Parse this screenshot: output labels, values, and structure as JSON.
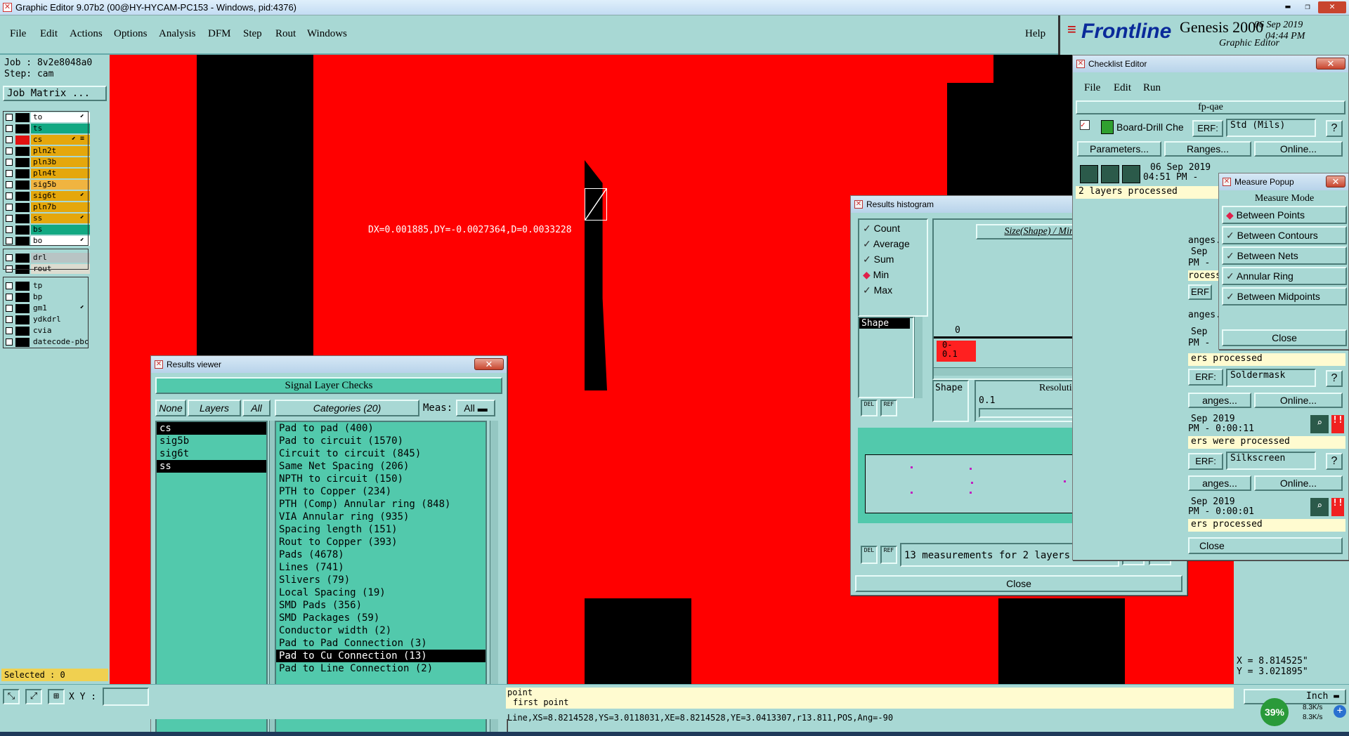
{
  "window": {
    "title": "Graphic Editor 9.07b2 (00@HY-HYCAM-PC153 - Windows, pid:4376)"
  },
  "menu": [
    "File",
    "Edit",
    "Actions",
    "Options",
    "Analysis",
    "DFM",
    "Step",
    "Rout",
    "Windows"
  ],
  "help": "Help",
  "brand": {
    "logo": "Frontline",
    "product": "Genesis 2000",
    "subtitle": "Graphic Editor",
    "date": "06 Sep 2019",
    "time": "04:44 PM"
  },
  "job": {
    "job_label": "Job : 8v2e8048a0",
    "step_label": "Step: cam",
    "job_matrix": "Job Matrix ..."
  },
  "layers": [
    {
      "name": "to",
      "color": "#ffffff",
      "sw": "#000000",
      "icon": "⬋"
    },
    {
      "name": "ts",
      "color": "#12a882",
      "sw": "#000000",
      "icon": ""
    },
    {
      "name": "cs",
      "color": "#e5a70c",
      "sw": "#e11111",
      "icon": "⬋ ≡"
    },
    {
      "name": "pln2t",
      "color": "#e5a70c",
      "sw": "#000000",
      "icon": ""
    },
    {
      "name": "pln3b",
      "color": "#e5a70c",
      "sw": "#000000",
      "icon": ""
    },
    {
      "name": "pln4t",
      "color": "#e5a70c",
      "sw": "#000000",
      "icon": ""
    },
    {
      "name": "sig5b",
      "color": "#f0b440",
      "sw": "#000000",
      "icon": ""
    },
    {
      "name": "sig6t",
      "color": "#e5a70c",
      "sw": "#000000",
      "icon": "⬋"
    },
    {
      "name": "pln7b",
      "color": "#e5a70c",
      "sw": "#000000",
      "icon": ""
    },
    {
      "name": "ss",
      "color": "#e5a70c",
      "sw": "#000000",
      "icon": "⬋"
    },
    {
      "name": "bs",
      "color": "#12a882",
      "sw": "#000000",
      "icon": ""
    },
    {
      "name": "bo",
      "color": "#ffffff",
      "sw": "#000000",
      "icon": "⬋"
    },
    {
      "name": "drl",
      "color": "#b8c4c4",
      "sw": "#000000",
      "icon": ""
    },
    {
      "name": "rout",
      "color": "#dcdcd0",
      "sw": "#000000",
      "icon": ""
    },
    {
      "name": "tp",
      "color": "#a8d8d4",
      "sw": "#000000",
      "icon": ""
    },
    {
      "name": "bp",
      "color": "#a8d8d4",
      "sw": "#000000",
      "icon": ""
    },
    {
      "name": "gm1",
      "color": "#a8d8d4",
      "sw": "#000000",
      "icon": "⬋"
    },
    {
      "name": "ydkdrl",
      "color": "#a8d8d4",
      "sw": "#000000",
      "icon": ""
    },
    {
      "name": "cvia",
      "color": "#a8d8d4",
      "sw": "#000000",
      "icon": ""
    },
    {
      "name": "datecode-pbc",
      "color": "#a8d8d4",
      "sw": "#000000",
      "icon": ""
    }
  ],
  "selected": "Selected : 0",
  "xy_label": "X Y :",
  "canvas": {
    "measure_text": "DX=0.001885,DY=-0.0027364,D=0.0033228"
  },
  "results_viewer": {
    "title": "Results viewer",
    "header": "Signal Layer Checks",
    "none": "None",
    "layers_btn": "Layers",
    "all": "All",
    "categories_btn": "Categories (20)",
    "meas_label": "Meas:",
    "meas_value": "All",
    "layer_list": [
      "cs",
      "sig5b",
      "sig6t",
      "ss"
    ],
    "layer_selected": [
      true,
      false,
      false,
      true
    ],
    "categories": [
      "Pad to pad (400)",
      "Pad to circuit (1570)",
      "Circuit to circuit (845)",
      "Same Net Spacing (206)",
      "NPTH to circuit (150)",
      "PTH to Copper (234)",
      "PTH (Comp) Annular ring (848)",
      "VIA Annular ring (935)",
      "Spacing length (151)",
      "Rout to Copper (393)",
      "Pads (4678)",
      "Lines (741)",
      "Slivers (79)",
      "Local Spacing (19)",
      "SMD Pads (356)",
      "SMD Packages (59)",
      "Conductor width (2)",
      "Pad to Pad Connection (3)",
      "Pad to Cu Connection (13)",
      "Pad to Line Connection (2)"
    ],
    "selected_category": 18
  },
  "histogram": {
    "title": "Results histogram",
    "options": [
      "Count",
      "Average",
      "Sum",
      "Min",
      "Max"
    ],
    "selected_option": "Min",
    "list_item": "Shape",
    "formula": "Size(Shape) / Min(Shape)",
    "bin_count": "0",
    "bin_label": "0-\n0.1",
    "shape_label": "Shape",
    "resolution_label": "Resolution",
    "resolution_value": "0.1",
    "status": "13 measurements for 2 layers",
    "close": "Close"
  },
  "checklist": {
    "title": "Checklist Editor",
    "menu": [
      "File",
      "Edit",
      "Run"
    ],
    "name": "fp-qae",
    "action_name": "Board-Drill Che",
    "erf_label": "ERF:",
    "erf_value": "Std (Mils)",
    "parameters": "Parameters...",
    "ranges": "Ranges...",
    "online": "Online...",
    "run_date": "06 Sep 2019",
    "run_time": "04:51 PM -",
    "processed1": "2 layers processed",
    "erf2": "Soldermask",
    "ranges2": "anges...",
    "online2": "Online...",
    "date2": "Sep 2019",
    "time2": "PM - 0:00:11",
    "processed2": "ers were processed",
    "erf3": "Silkscreen",
    "ranges3": "anges...",
    "online3": "Online...",
    "date3": "Sep 2019",
    "time3": "PM - 0:00:01",
    "processed3": "ers processed",
    "fragments": [
      "anges.",
      "Sep",
      "PM -",
      "rocesse",
      "ERF",
      "anges.",
      "Sep",
      "PM -"
    ],
    "processed_mid": "ers processed",
    "close": "Close"
  },
  "measure_popup": {
    "title": "Measure Popup",
    "heading": "Measure Mode",
    "modes": [
      "Between Points",
      "Between Contours",
      "Between Nets",
      "Annular Ring",
      "Between Midpoints"
    ],
    "selected": "Between Points",
    "close": "Close"
  },
  "coords": {
    "x": "X = 8.814525\"",
    "y": "Y = 3.021895\""
  },
  "unit": "Inch",
  "prompt": {
    "line1": "point",
    "line2": "first point"
  },
  "status_line": "Line,XS=8.8214528,YS=3.0118031,XE=8.8214528,YE=3.0413307,r13.811,POS,Ang=-90",
  "net": {
    "percent": "39%",
    "up": "8.3K/s",
    "down": "8.3K/s"
  }
}
